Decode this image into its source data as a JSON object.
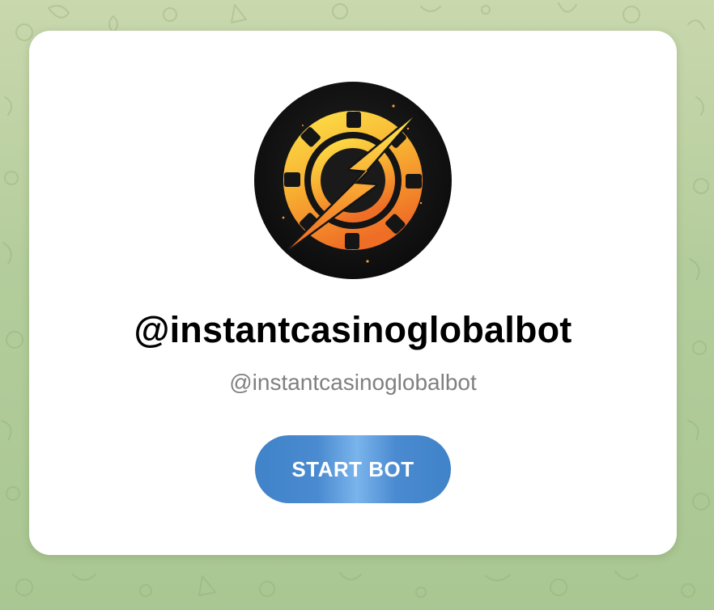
{
  "bot": {
    "title": "@instantcasinoglobalbot",
    "username": "@instantcasinoglobalbot",
    "avatar_icon": "lightning-casino-chip-icon"
  },
  "actions": {
    "start_label": "START BOT"
  },
  "colors": {
    "background": "#b3cc9b",
    "card": "#ffffff",
    "button": "#4a8ad0",
    "button_highlight": "#7ab4ec",
    "title": "#000000",
    "username": "#808080",
    "chip_yellow": "#fbd23c",
    "chip_orange": "#f07a2a",
    "avatar_bg": "#141414"
  }
}
